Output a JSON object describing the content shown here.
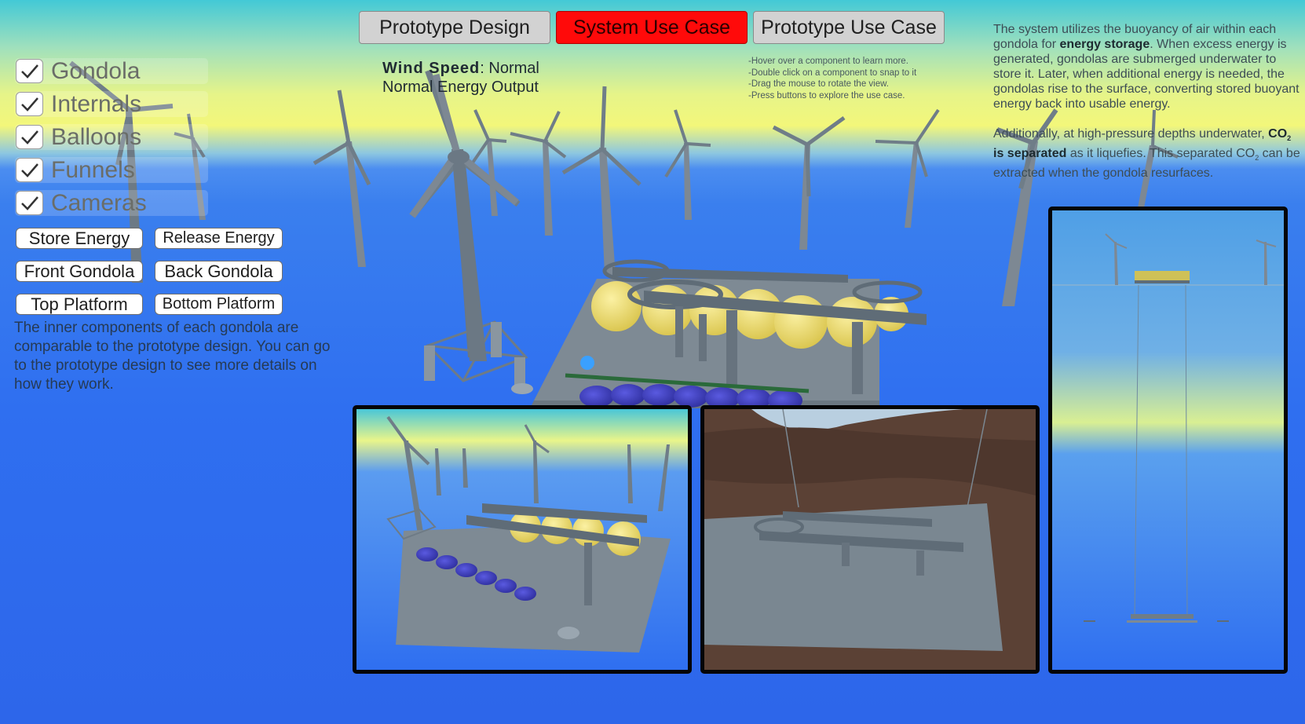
{
  "tabs": {
    "prototype_design": "Prototype Design",
    "system_use_case": "System Use Case",
    "prototype_use_case": "Prototype Use Case"
  },
  "status": {
    "wind_label": "Wind Speed",
    "wind_value": ": Normal",
    "energy_output": "Normal Energy Output"
  },
  "hints": [
    "-Hover over a component to learn more.",
    "-Double click on a component to snap to it",
    "-Drag the mouse to rotate the view.",
    "-Press buttons to explore the use case."
  ],
  "info": {
    "p1_a": "The system utilizes the buoyancy of air within each gondola for ",
    "p1_b": "energy storage",
    "p1_c": ". When excess energy is generated, gondolas are submerged underwater to store it. Later, when additional energy is needed, the gondolas rise to the surface, converting stored buoyant energy back into usable energy.",
    "p2_a": "Additionally, at high-pressure depths underwater, ",
    "p2_b": "CO",
    "p2_sub": "2",
    "p2_c": " is separated",
    "p2_d": " as it liquefies. This separated CO",
    "p2_sub2": "2",
    "p2_e": " can be extracted when the gondola resurfaces."
  },
  "toggles": [
    {
      "label": "Gondola",
      "checked": true
    },
    {
      "label": "Internals",
      "checked": true
    },
    {
      "label": "Balloons",
      "checked": true
    },
    {
      "label": "Funnels",
      "checked": true
    },
    {
      "label": "Cameras",
      "checked": true
    }
  ],
  "buttons": {
    "store_energy": "Store Energy",
    "release_energy": "Release Energy",
    "front_gondola": "Front Gondola",
    "back_gondola": "Back Gondola",
    "top_platform": "Top Platform",
    "bottom_platform": "Bottom Platform"
  },
  "description": "The inner components of each gondola are comparable to the prototype design. You can go to the prototype design to see more details on how they work.",
  "colors": {
    "active_tab": "#ff0a0a",
    "tab": "#d2d2d2",
    "ocean": "#2f6ff0",
    "balloon": "#e8d76a",
    "tank": "#3c3cc0",
    "seabed": "#5a4035"
  }
}
